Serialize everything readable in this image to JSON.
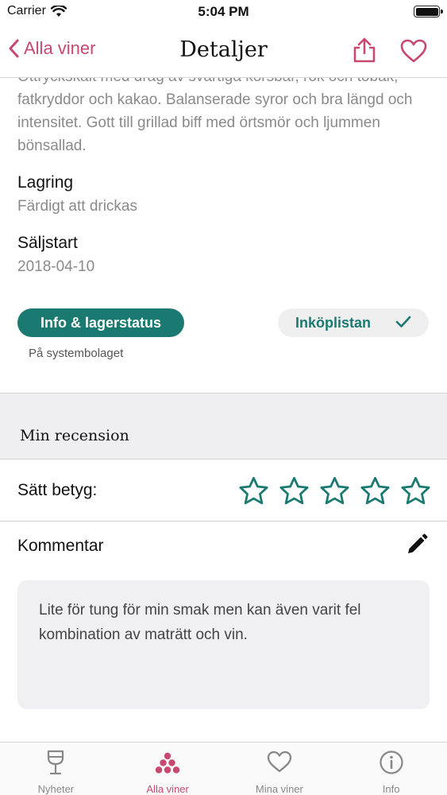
{
  "status_bar": {
    "carrier": "Carrier",
    "time": "5:04 PM"
  },
  "nav": {
    "back_label": "Alla viner",
    "title": "Detaljer"
  },
  "details": {
    "description": "Ottryckskalt med drag av svartiga körsbär, rök och tobak, fatkryddor och kakao. Balanserade syror och bra längd och intensitet. Gott till grillad biff med örtsmör och ljummen bönsallad.",
    "storage_label": "Lagring",
    "storage_value": "Färdigt att drickas",
    "sale_start_label": "Säljstart",
    "sale_start_value": "2018-04-10"
  },
  "actions": {
    "info_button": "Info & lagerstatus",
    "info_sub": "På systembolaget",
    "shopping_list_button": "Inköplistan"
  },
  "review": {
    "section_title": "Min recension",
    "rating_label": "Sätt betyg:",
    "rating_value": 0,
    "rating_max": 5,
    "comment_label": "Kommentar",
    "comment_text": "Lite för tung för min smak men kan även varit fel kombination av maträtt och vin."
  },
  "tabs": [
    {
      "label": "Nyheter",
      "icon": "wine-glass-icon",
      "active": false
    },
    {
      "label": "Alla viner",
      "icon": "grapes-icon",
      "active": true
    },
    {
      "label": "Mina viner",
      "icon": "heart-icon",
      "active": false
    },
    {
      "label": "Info",
      "icon": "info-icon",
      "active": false
    }
  ],
  "colors": {
    "accent": "#c8496f",
    "teal": "#1a7a72",
    "muted_text": "#8a8a8a"
  }
}
